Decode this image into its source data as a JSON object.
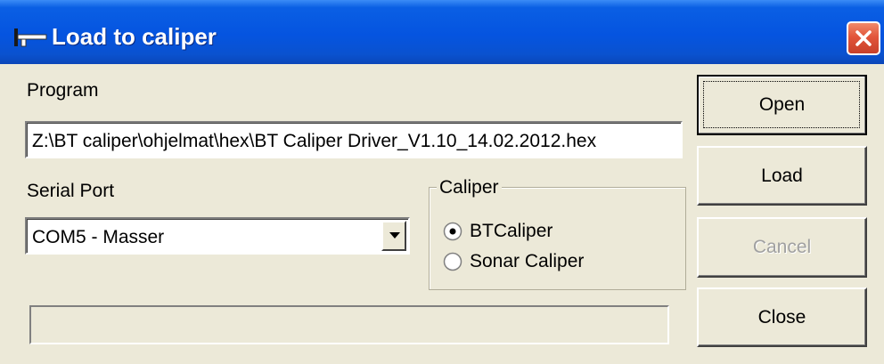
{
  "window": {
    "title": "Load to caliper",
    "colors": {
      "titlebar": "#0554e0",
      "close": "#e2553a",
      "face": "#ece9d8"
    }
  },
  "program": {
    "label": "Program",
    "value": "Z:\\BT caliper\\ohjelmat\\hex\\BT Caliper Driver_V1.10_14.02.2012.hex"
  },
  "serial_port": {
    "label": "Serial Port",
    "selected": "COM5 - Masser"
  },
  "caliper": {
    "legend": "Caliper",
    "options": [
      {
        "label": "BTCaliper",
        "checked": true
      },
      {
        "label": "Sonar Caliper",
        "checked": false
      }
    ]
  },
  "buttons": {
    "open": "Open",
    "load": "Load",
    "cancel": "Cancel",
    "close": "Close"
  },
  "progress": {
    "value": 0
  },
  "icons": {
    "title": "caliper-icon",
    "close": "close-icon",
    "dropdown": "chevron-down-icon"
  }
}
